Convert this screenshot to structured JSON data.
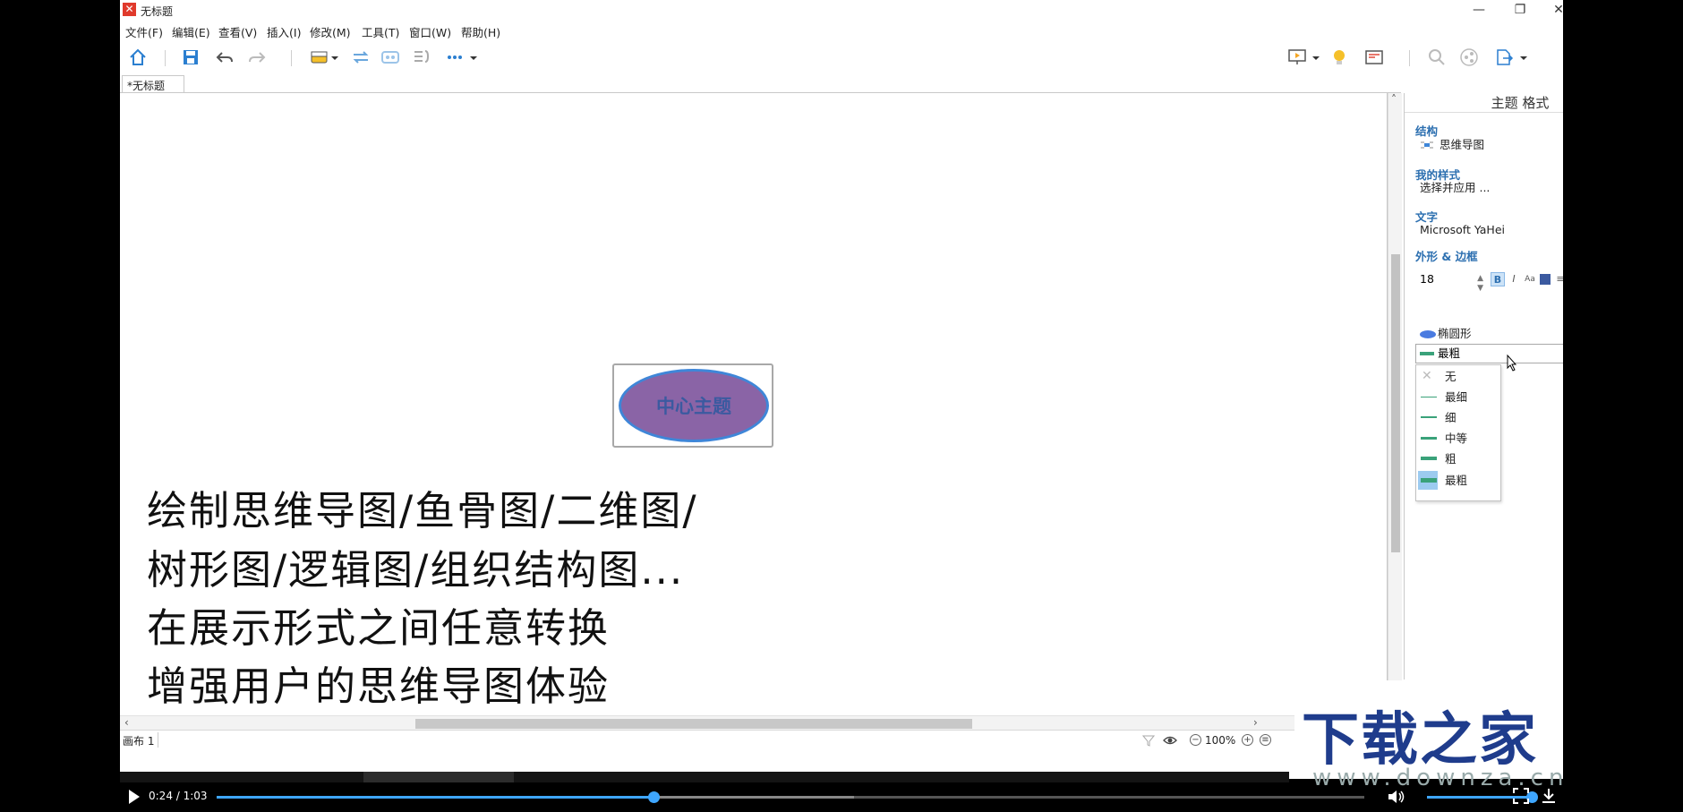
{
  "window": {
    "title": "无标题",
    "logo": "✕"
  },
  "menu": [
    "文件(F)",
    "编辑(E)",
    "查看(V)",
    "插入(I)",
    "修改(M)",
    "工具(T)",
    "窗口(W)",
    "帮助(H)"
  ],
  "toolbar_icons": [
    "home-icon",
    "save-icon",
    "undo-icon",
    "redo-icon",
    "topic-icon",
    "relationship-icon",
    "boundary-icon",
    "summary-icon",
    "more-icon",
    "presentation-icon",
    "idea-icon",
    "outline-icon",
    "search-icon",
    "share-icon",
    "export-icon"
  ],
  "doc_tab": "*无标题",
  "topic": {
    "label": "中心主题",
    "fill": "#8a64a6",
    "border": "#3f86d8",
    "text_color": "#3b5aa0"
  },
  "captions": [
    "绘制思维导图/鱼骨图/二维图/",
    "树形图/逻辑图/组织结构图...",
    "在展示形式之间任意转换",
    "增强用户的思维导图体验"
  ],
  "status": {
    "sheet": "画布 1",
    "zoom": "100%"
  },
  "panel": {
    "title": "主题 格式",
    "structure_head": "结构",
    "structure_value": "思维导图",
    "mystyle_head": "我的样式",
    "mystyle_value": "选择并应用 ...",
    "text_head": "文字",
    "font_value": "Microsoft YaHei",
    "font_size": "18",
    "bold": "B",
    "italic": "I",
    "case": "Aa",
    "text_color": "#3b5aa0",
    "align": "≡",
    "weight": "M",
    "shape_head": "外形 & 边框",
    "shape_value": "椭圆形",
    "shape_color": "#8a64a6",
    "line_value": "最粗",
    "line_color": "#3f86d8",
    "extra_color": "#3f86d8",
    "line_options": [
      "无",
      "最细",
      "细",
      "中等",
      "粗",
      "最粗"
    ],
    "line_selected": "最粗"
  },
  "watermark": {
    "text": "下载之家",
    "url": "www.downza.cn"
  },
  "player": {
    "time": "0:24 / 1:03",
    "progress": 0.381,
    "buffered": 0.555,
    "volume": 1.0
  },
  "accent": "#3ea6ff"
}
